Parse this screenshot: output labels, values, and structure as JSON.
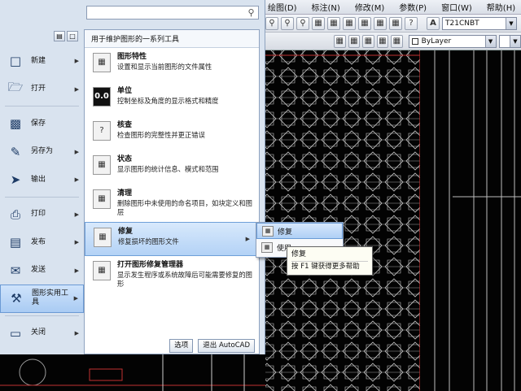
{
  "menubar": {
    "items": [
      "绘图(D)",
      "标注(N)",
      "修改(M)",
      "参数(P)",
      "窗口(W)",
      "帮助(H)"
    ]
  },
  "toolbar": {
    "text_style": "T21CNBT",
    "layer": "ByLayer"
  },
  "search": {
    "placeholder": ""
  },
  "left_commands": [
    {
      "label": "新建",
      "icon": "new-file-icon",
      "has_arrow": true
    },
    {
      "label": "打开",
      "icon": "open-folder-icon",
      "has_arrow": true
    },
    {
      "label": "保存",
      "icon": "save-disk-icon",
      "has_arrow": false
    },
    {
      "label": "另存为",
      "icon": "save-as-icon",
      "has_arrow": true
    },
    {
      "label": "输出",
      "icon": "export-icon",
      "has_arrow": true
    },
    {
      "label": "打印",
      "icon": "printer-icon",
      "has_arrow": true
    },
    {
      "label": "发布",
      "icon": "publish-icon",
      "has_arrow": true
    },
    {
      "label": "发送",
      "icon": "send-icon",
      "has_arrow": true
    },
    {
      "label": "图形实用工具",
      "icon": "utilities-icon",
      "has_arrow": true
    },
    {
      "label": "关闭",
      "icon": "close-folder-icon",
      "has_arrow": true
    }
  ],
  "panel": {
    "header": "用于维护图形的一系列工具",
    "items": [
      {
        "title": "图形特性",
        "desc": "设置和显示当前图形的文件属性"
      },
      {
        "title": "单位",
        "desc": "控制坐标及角度的显示格式和精度",
        "icon_text": "0.0"
      },
      {
        "title": "核查",
        "desc": "检查图形的完整性并更正错误",
        "icon_text": "?"
      },
      {
        "title": "状态",
        "desc": "显示图形的统计信息、模式和范围"
      },
      {
        "title": "清理",
        "desc": "删除图形中未使用的命名项目，如块定义和图层"
      },
      {
        "title": "修复",
        "desc": "修复损坏的图形文件"
      },
      {
        "title": "打开图形修复管理器",
        "desc": "显示发生程序或系统故障后可能需要修复的图形"
      }
    ],
    "options_button": "选项",
    "exit_button": "退出 AutoCAD"
  },
  "flyout": {
    "items": [
      "修复",
      "使用"
    ]
  },
  "tooltip": {
    "title": "修复",
    "help": "按 F1 键获得更多帮助"
  },
  "colors": {
    "highlight": "#b3d2f6",
    "canvas": "#030303",
    "pattern": "#c9c9c9",
    "red_line": "#c03030"
  }
}
